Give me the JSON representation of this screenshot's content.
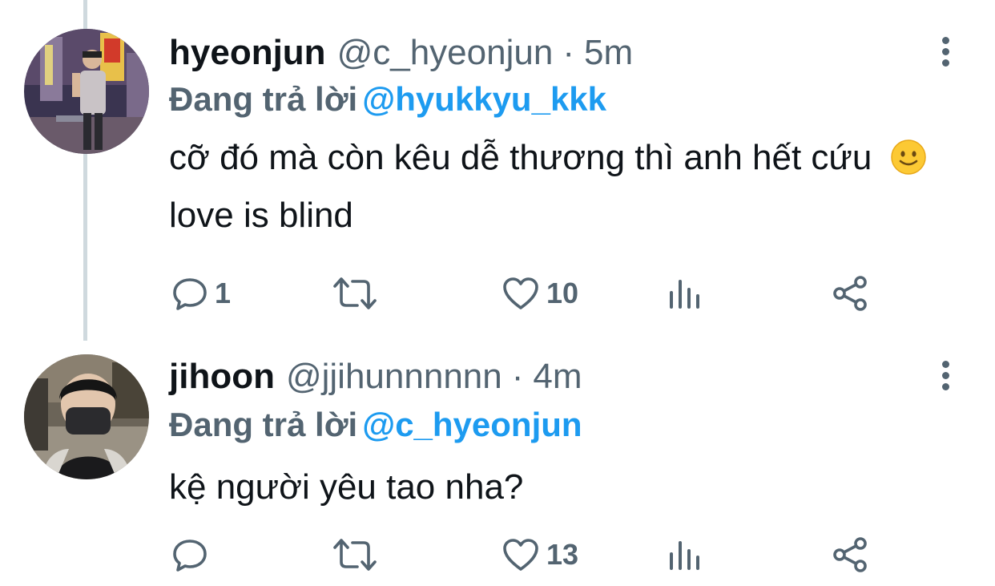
{
  "tweets": [
    {
      "display_name": "hyeonjun",
      "handle": "@c_hyeonjun",
      "separator": "·",
      "time": "5m",
      "reply_prefix": "Đang trả lời",
      "reply_to": "@hyukkyu_kkk",
      "text_before_emoji": "cỡ đó mà còn kêu dễ thương thì anh hết cứu",
      "emoji": "slightly-smiling-face",
      "text_after_emoji": "love is blind",
      "counts": {
        "replies": "1",
        "retweets": "",
        "likes": "10"
      }
    },
    {
      "display_name": "jihoon",
      "handle": "@jjihunnnnnn",
      "separator": "·",
      "time": "4m",
      "reply_prefix": "Đang trả lời",
      "reply_to": "@c_hyeonjun",
      "text": "kệ người yêu tao nha?",
      "counts": {
        "replies": "",
        "retweets": "",
        "likes": "13"
      }
    }
  ],
  "icons": {
    "reply": "reply-icon",
    "retweet": "retweet-icon",
    "like": "heart-icon",
    "analytics": "analytics-icon",
    "share": "share-icon",
    "more": "more-vertical-icon"
  },
  "colors": {
    "text_primary": "#0f1419",
    "text_secondary": "#536471",
    "mention": "#1d9bf0",
    "thread_line": "#cfd9de",
    "background": "#ffffff"
  }
}
